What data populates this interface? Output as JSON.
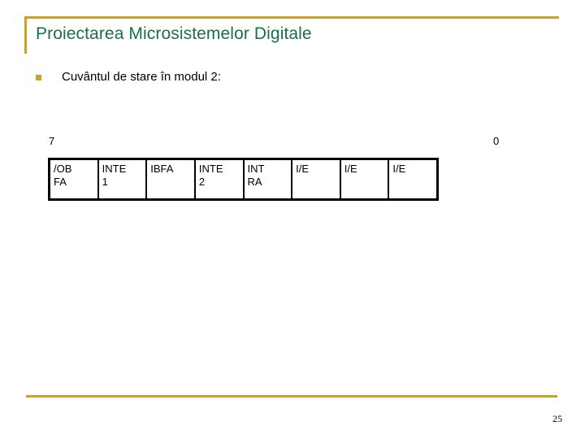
{
  "slide": {
    "title": "Proiectarea Microsistemelor Digitale",
    "bullet_text": "Cuvântul de stare în modul 2:",
    "page_number": "25",
    "accent_color": "#c9a227",
    "title_color": "#1a6e4e",
    "bullet_color": "#c9a227"
  },
  "status_word": {
    "msb_label": "7",
    "lsb_label": "0",
    "cells": [
      {
        "line1": "/OB",
        "line2": "FA"
      },
      {
        "line1": "INTE",
        "line2": "1"
      },
      {
        "line1": "IBFA",
        "line2": ""
      },
      {
        "line1": "INTE",
        "line2": "2"
      },
      {
        "line1": "INT",
        "line2": "RA"
      },
      {
        "line1": "I/E",
        "line2": ""
      },
      {
        "line1": "I/E",
        "line2": ""
      },
      {
        "line1": "I/E",
        "line2": ""
      }
    ]
  }
}
